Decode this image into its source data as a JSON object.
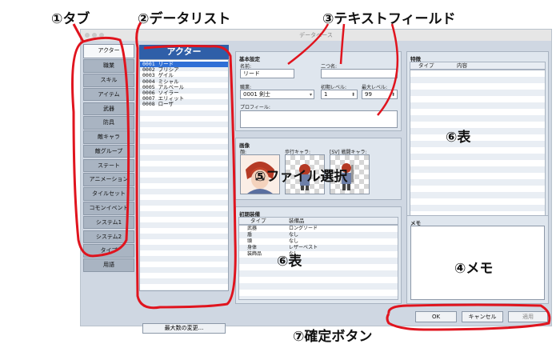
{
  "annotations": {
    "tab": "①タブ",
    "datalist": "②データリスト",
    "textfield": "③テキストフィールド",
    "memo": "④メモ",
    "fileselect": "⑤ファイル選択",
    "table_traits": "⑥表",
    "table_equip": "⑥表",
    "confirm": "⑦確定ボタン"
  },
  "window": {
    "title": "データベース"
  },
  "tabs": [
    "アクター",
    "職業",
    "スキル",
    "アイテム",
    "武器",
    "防具",
    "敵キャラ",
    "敵グループ",
    "ステート",
    "アニメーション",
    "タイルセット",
    "コモンイベント",
    "システム1",
    "システム2",
    "タイプ",
    "用語"
  ],
  "list": {
    "header": "アクター",
    "items": [
      "0001 リード",
      "0002 プリシア",
      "0003 ゲイル",
      "0004 ミシャル",
      "0005 アルベール",
      "0006 ソイラー",
      "0007 エリィット",
      "0008 ローザ"
    ],
    "max_button": "最大数の変更..."
  },
  "basic": {
    "title": "基本設定",
    "name_label": "名前:",
    "name_value": "リード",
    "nickname_label": "二つ名:",
    "nickname_value": "",
    "class_label": "職業:",
    "class_value": "0001 剣士",
    "initial_level_label": "初期レベル:",
    "initial_level_value": "1",
    "max_level_label": "最大レベル:",
    "max_level_value": "99",
    "profile_label": "プロフィール:",
    "profile_value": ""
  },
  "images": {
    "title": "画像",
    "face_label": "顔:",
    "walk_label": "歩行キャラ:",
    "battler_label": "[SV] 戦闘キャラ:"
  },
  "equipment": {
    "title": "初期装備",
    "columns": [
      "タイプ",
      "装備品"
    ],
    "rows": [
      [
        "武器",
        "ロングソード"
      ],
      [
        "盾",
        "なし"
      ],
      [
        "頭",
        "なし"
      ],
      [
        "身体",
        "レザーベスト"
      ],
      [
        "装飾品",
        "なし"
      ]
    ]
  },
  "traits": {
    "title": "特徴",
    "columns": [
      "タイプ",
      "内容"
    ]
  },
  "memo": {
    "title": "メモ",
    "value": ""
  },
  "buttons": {
    "ok": "OK",
    "cancel": "キャンセル",
    "apply": "適用"
  },
  "colors": {
    "accent": "#2f5fa8",
    "annotation_line": "#e0141e",
    "window_bg": "#cfd7e2"
  }
}
